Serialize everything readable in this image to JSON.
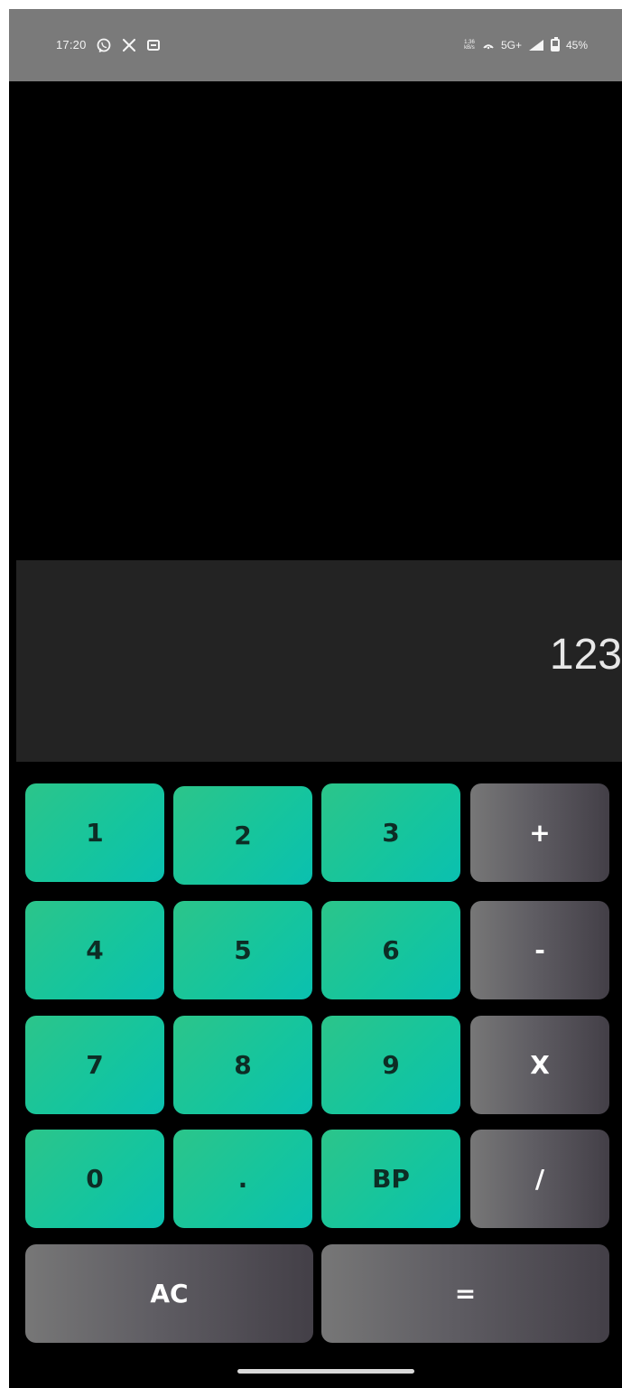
{
  "status_bar": {
    "time": "17:20",
    "left_icons": [
      "whatsapp-icon",
      "x-icon",
      "cast-icon"
    ],
    "speed_top": "1.36",
    "speed_bottom": "kB/s",
    "network": "5G+",
    "battery": "45%"
  },
  "display": {
    "value": "123"
  },
  "keypad": {
    "rows": [
      [
        "1",
        "2",
        "3",
        "+"
      ],
      [
        "4",
        "5",
        "6",
        "-"
      ],
      [
        "7",
        "8",
        "9",
        "X"
      ],
      [
        "0",
        ".",
        "BP",
        "/"
      ]
    ],
    "bottom": [
      "AC",
      "="
    ]
  },
  "colors": {
    "digit_key_gradient_start": "#2cc58a",
    "digit_key_gradient_end": "#0ac0b0",
    "operator_key_gradient_start": "#777777",
    "operator_key_gradient_end": "#433f47",
    "background": "#000000",
    "display_background": "#232323"
  }
}
